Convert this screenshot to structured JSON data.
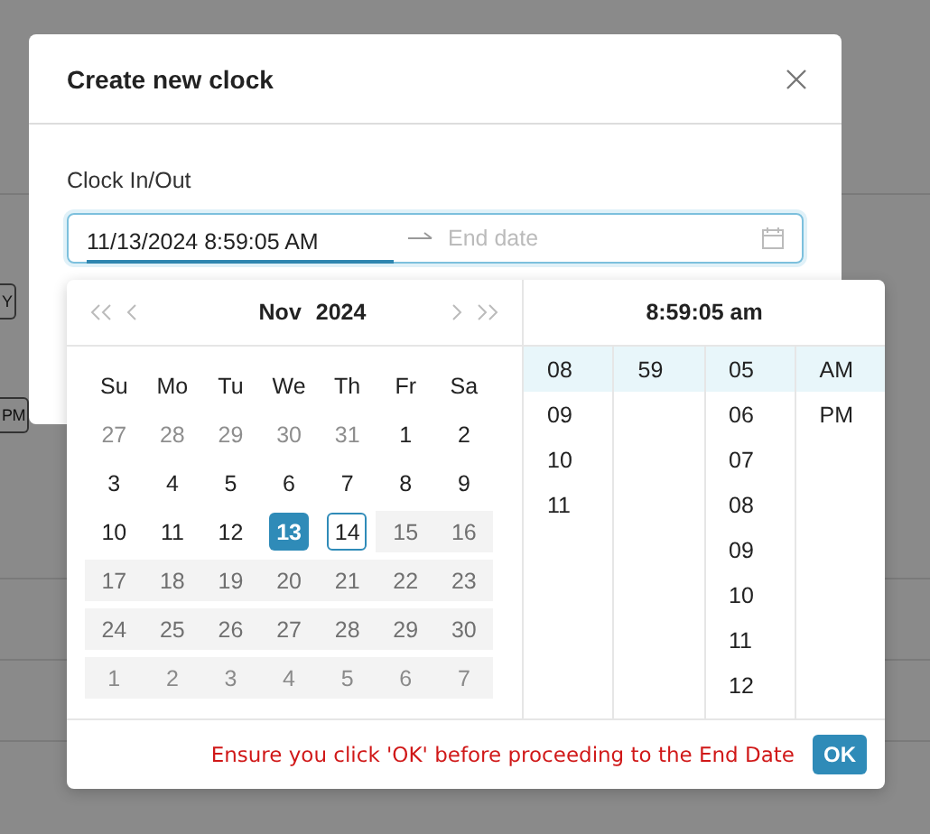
{
  "background_page": {
    "fragments": [
      {
        "text": "Y",
        "kind": "chip"
      },
      {
        "text": "PM",
        "kind": "chip"
      }
    ]
  },
  "dialog": {
    "title": "Create new clock",
    "field_label": "Clock In/Out",
    "start_value": "11/13/2024 8:59:05 AM",
    "end_placeholder": "End date"
  },
  "picker": {
    "month": "Nov",
    "year": "2024",
    "time_title": "8:59:05 am",
    "weekdays": [
      "Su",
      "Mo",
      "Tu",
      "We",
      "Th",
      "Fr",
      "Sa"
    ],
    "weeks": [
      [
        {
          "label": "27",
          "in_month": false,
          "disabled": false,
          "selected": false,
          "today": false
        },
        {
          "label": "28",
          "in_month": false,
          "disabled": false,
          "selected": false,
          "today": false
        },
        {
          "label": "29",
          "in_month": false,
          "disabled": false,
          "selected": false,
          "today": false
        },
        {
          "label": "30",
          "in_month": false,
          "disabled": false,
          "selected": false,
          "today": false
        },
        {
          "label": "31",
          "in_month": false,
          "disabled": false,
          "selected": false,
          "today": false
        },
        {
          "label": "1",
          "in_month": true,
          "disabled": false,
          "selected": false,
          "today": false
        },
        {
          "label": "2",
          "in_month": true,
          "disabled": false,
          "selected": false,
          "today": false
        }
      ],
      [
        {
          "label": "3",
          "in_month": true,
          "disabled": false,
          "selected": false,
          "today": false
        },
        {
          "label": "4",
          "in_month": true,
          "disabled": false,
          "selected": false,
          "today": false
        },
        {
          "label": "5",
          "in_month": true,
          "disabled": false,
          "selected": false,
          "today": false
        },
        {
          "label": "6",
          "in_month": true,
          "disabled": false,
          "selected": false,
          "today": false
        },
        {
          "label": "7",
          "in_month": true,
          "disabled": false,
          "selected": false,
          "today": false
        },
        {
          "label": "8",
          "in_month": true,
          "disabled": false,
          "selected": false,
          "today": false
        },
        {
          "label": "9",
          "in_month": true,
          "disabled": false,
          "selected": false,
          "today": false
        }
      ],
      [
        {
          "label": "10",
          "in_month": true,
          "disabled": false,
          "selected": false,
          "today": false
        },
        {
          "label": "11",
          "in_month": true,
          "disabled": false,
          "selected": false,
          "today": false
        },
        {
          "label": "12",
          "in_month": true,
          "disabled": false,
          "selected": false,
          "today": false
        },
        {
          "label": "13",
          "in_month": true,
          "disabled": false,
          "selected": true,
          "today": false
        },
        {
          "label": "14",
          "in_month": true,
          "disabled": false,
          "selected": false,
          "today": true
        },
        {
          "label": "15",
          "in_month": true,
          "disabled": true,
          "selected": false,
          "today": false
        },
        {
          "label": "16",
          "in_month": true,
          "disabled": true,
          "selected": false,
          "today": false
        }
      ],
      [
        {
          "label": "17",
          "in_month": true,
          "disabled": true,
          "selected": false,
          "today": false
        },
        {
          "label": "18",
          "in_month": true,
          "disabled": true,
          "selected": false,
          "today": false
        },
        {
          "label": "19",
          "in_month": true,
          "disabled": true,
          "selected": false,
          "today": false
        },
        {
          "label": "20",
          "in_month": true,
          "disabled": true,
          "selected": false,
          "today": false
        },
        {
          "label": "21",
          "in_month": true,
          "disabled": true,
          "selected": false,
          "today": false
        },
        {
          "label": "22",
          "in_month": true,
          "disabled": true,
          "selected": false,
          "today": false
        },
        {
          "label": "23",
          "in_month": true,
          "disabled": true,
          "selected": false,
          "today": false
        }
      ],
      [
        {
          "label": "24",
          "in_month": true,
          "disabled": true,
          "selected": false,
          "today": false
        },
        {
          "label": "25",
          "in_month": true,
          "disabled": true,
          "selected": false,
          "today": false
        },
        {
          "label": "26",
          "in_month": true,
          "disabled": true,
          "selected": false,
          "today": false
        },
        {
          "label": "27",
          "in_month": true,
          "disabled": true,
          "selected": false,
          "today": false
        },
        {
          "label": "28",
          "in_month": true,
          "disabled": true,
          "selected": false,
          "today": false
        },
        {
          "label": "29",
          "in_month": true,
          "disabled": true,
          "selected": false,
          "today": false
        },
        {
          "label": "30",
          "in_month": true,
          "disabled": true,
          "selected": false,
          "today": false
        }
      ],
      [
        {
          "label": "1",
          "in_month": false,
          "disabled": true,
          "selected": false,
          "today": false
        },
        {
          "label": "2",
          "in_month": false,
          "disabled": true,
          "selected": false,
          "today": false
        },
        {
          "label": "3",
          "in_month": false,
          "disabled": true,
          "selected": false,
          "today": false
        },
        {
          "label": "4",
          "in_month": false,
          "disabled": true,
          "selected": false,
          "today": false
        },
        {
          "label": "5",
          "in_month": false,
          "disabled": true,
          "selected": false,
          "today": false
        },
        {
          "label": "6",
          "in_month": false,
          "disabled": true,
          "selected": false,
          "today": false
        },
        {
          "label": "7",
          "in_month": false,
          "disabled": true,
          "selected": false,
          "today": false
        }
      ]
    ],
    "time_columns": [
      [
        {
          "label": "08",
          "selected": true
        },
        {
          "label": "09",
          "selected": false
        },
        {
          "label": "10",
          "selected": false
        },
        {
          "label": "11",
          "selected": false
        }
      ],
      [
        {
          "label": "59",
          "selected": true
        }
      ],
      [
        {
          "label": "05",
          "selected": true
        },
        {
          "label": "06",
          "selected": false
        },
        {
          "label": "07",
          "selected": false
        },
        {
          "label": "08",
          "selected": false
        },
        {
          "label": "09",
          "selected": false
        },
        {
          "label": "10",
          "selected": false
        },
        {
          "label": "11",
          "selected": false
        },
        {
          "label": "12",
          "selected": false
        }
      ],
      [
        {
          "label": "AM",
          "selected": true
        },
        {
          "label": "PM",
          "selected": false
        }
      ]
    ],
    "footer_message": "Ensure you click 'OK' before proceeding to the End Date",
    "ok_label": "OK"
  }
}
